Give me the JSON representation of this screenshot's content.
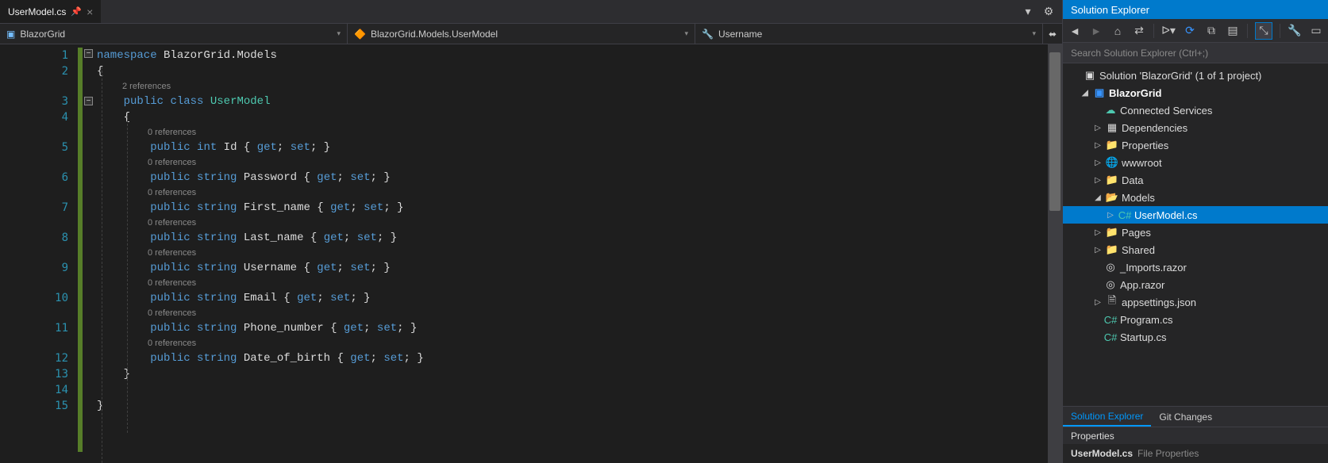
{
  "tab": {
    "name": "UserModel.cs"
  },
  "nav": {
    "scope1": "BlazorGrid",
    "scope2": "BlazorGrid.Models.UserModel",
    "scope3": "Username"
  },
  "codelens": {
    "class": "2 references",
    "prop": "0 references"
  },
  "code": {
    "l1": {
      "kw": "namespace",
      "txt": " BlazorGrid.Models"
    },
    "l2": "{",
    "l3": {
      "p1": "    ",
      "kw1": "public",
      "kw2": "class",
      "tp": "UserModel"
    },
    "l4": "    {",
    "l5": {
      "kw1": "public",
      "kw2": "int",
      "id": " Id { ",
      "g": "get",
      "s1": "; ",
      "s": "set",
      "s2": "; }"
    },
    "l6": {
      "kw1": "public",
      "kw2": "string",
      "id": " Password { ",
      "g": "get",
      "s1": "; ",
      "s": "set",
      "s2": "; }"
    },
    "l7": {
      "kw1": "public",
      "kw2": "string",
      "id": " First_name { ",
      "g": "get",
      "s1": "; ",
      "s": "set",
      "s2": "; }"
    },
    "l8": {
      "kw1": "public",
      "kw2": "string",
      "id": " Last_name { ",
      "g": "get",
      "s1": "; ",
      "s": "set",
      "s2": "; }"
    },
    "l9": {
      "kw1": "public",
      "kw2": "string",
      "id": " Username { ",
      "g": "get",
      "s1": "; ",
      "s": "set",
      "s2": "; }"
    },
    "l10": {
      "kw1": "public",
      "kw2": "string",
      "id": " Email { ",
      "g": "get",
      "s1": "; ",
      "s": "set",
      "s2": "; }"
    },
    "l11": {
      "kw1": "public",
      "kw2": "string",
      "id": " Phone_number { ",
      "g": "get",
      "s1": "; ",
      "s": "set",
      "s2": "; }"
    },
    "l12": {
      "kw1": "public",
      "kw2": "string",
      "id": " Date_of_birth { ",
      "g": "get",
      "s1": "; ",
      "s": "set",
      "s2": "; }"
    },
    "l13": "    }",
    "l15": "}"
  },
  "lines": [
    "1",
    "2",
    "3",
    "4",
    "5",
    "6",
    "7",
    "8",
    "9",
    "10",
    "11",
    "12",
    "13",
    "14",
    "15"
  ],
  "sidebar": {
    "title": "Solution Explorer",
    "searchPlaceholder": "Search Solution Explorer (Ctrl+;)",
    "sol": "Solution 'BlazorGrid' (1 of 1 project)",
    "proj": "BlazorGrid",
    "nodes": {
      "connected": "Connected Services",
      "deps": "Dependencies",
      "props": "Properties",
      "www": "wwwroot",
      "data": "Data",
      "models": "Models",
      "usermodel": "UserModel.cs",
      "pages": "Pages",
      "shared": "Shared",
      "imports": "_Imports.razor",
      "app": "App.razor",
      "appsettings": "appsettings.json",
      "program": "Program.cs",
      "startup": "Startup.cs"
    }
  },
  "footer": {
    "t1": "Solution Explorer",
    "t2": "Git Changes"
  },
  "properties": {
    "title": "Properties",
    "item": "UserModel.cs",
    "sub": "File Properties"
  }
}
